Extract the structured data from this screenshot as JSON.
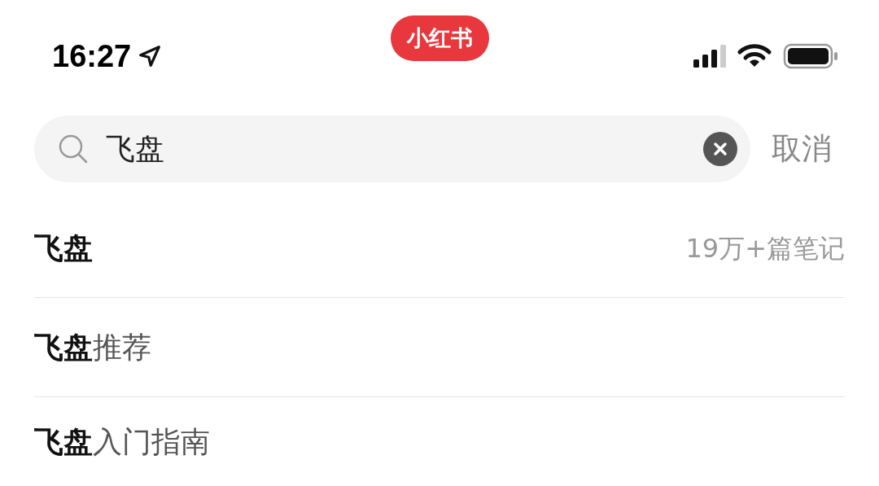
{
  "status_bar": {
    "time": "16:27",
    "app_badge": "小红书"
  },
  "search": {
    "value": "飞盘",
    "cancel": "取消"
  },
  "suggestions": [
    {
      "text": "**飞盘**",
      "count": "19万+篇笔记"
    },
    {
      "text": "**飞盘**推荐"
    },
    {
      "text": "**飞盘**入门指南"
    }
  ]
}
